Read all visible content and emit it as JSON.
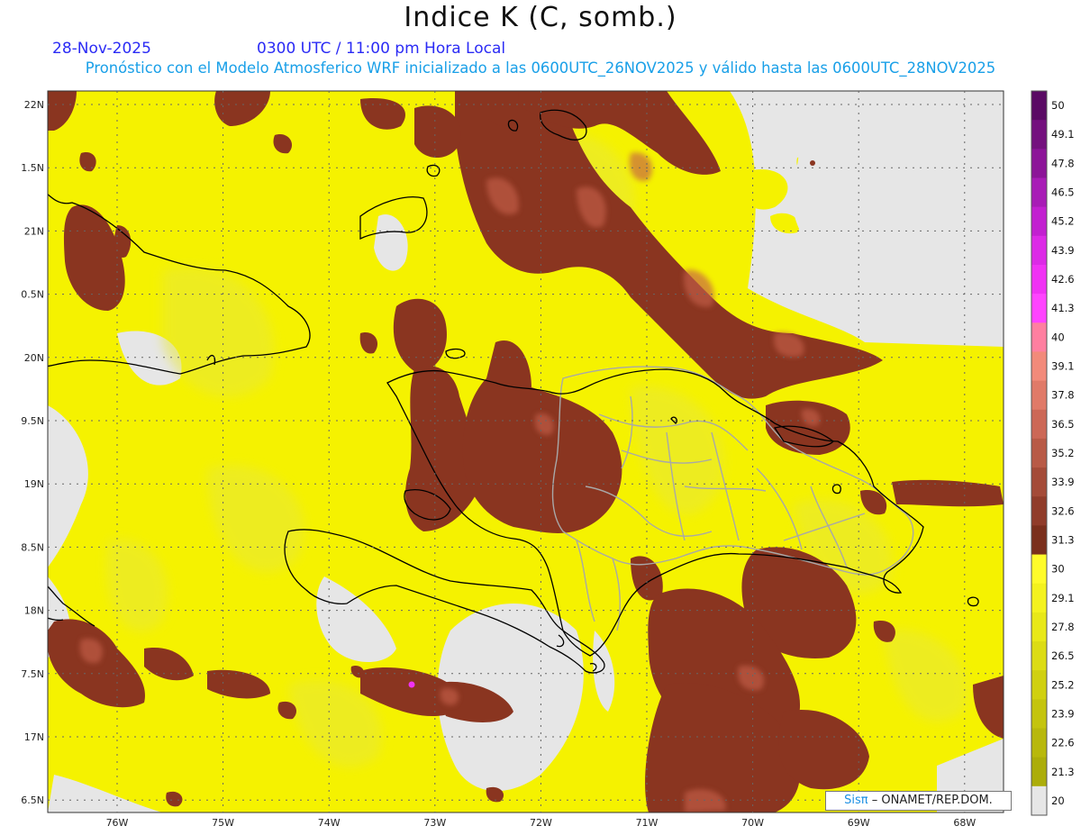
{
  "header": {
    "title": "Indice K (C, somb.)",
    "date": "28-Nov-2025",
    "time": "0300 UTC / 11:00 pm Hora Local",
    "subtitle": "Pronóstico con el Modelo Atmosferico WRF inicializado a las 0600UTC_26NOV2025 y válido hasta las  0600UTC_28NOV2025"
  },
  "map": {
    "lat_ticks": [
      "22N",
      "1.5N",
      "21N",
      "0.5N",
      "20N",
      "9.5N",
      "19N",
      "8.5N",
      "18N",
      "7.5N",
      "17N",
      "6.5N"
    ],
    "lon_ticks": [
      "76W",
      "75W",
      "74W",
      "73W",
      "72W",
      "71W",
      "70W",
      "69W",
      "68W"
    ],
    "colors": {
      "background_no_data": "#e6e6e6",
      "field_low": "#f5f200",
      "field_mid": "#e8e83a",
      "field_high": "#8a3520",
      "field_peak": "#c45f4a",
      "coastline": "#000000",
      "provinces": "#a8a8a8"
    }
  },
  "colorbar": {
    "labels": [
      "50",
      "49.1",
      "47.8",
      "46.5",
      "45.2",
      "43.9",
      "42.6",
      "41.3",
      "40",
      "39.1",
      "37.8",
      "36.5",
      "35.2",
      "33.9",
      "32.6",
      "31.3",
      "30",
      "29.1",
      "27.8",
      "26.5",
      "25.2",
      "23.9",
      "22.6",
      "21.3",
      "20"
    ],
    "colors": [
      "#5a0a64",
      "#74107e",
      "#8c1498",
      "#a81cb6",
      "#c220d0",
      "#dc2ae6",
      "#f032f4",
      "#ff44ff",
      "#ff7fa0",
      "#f28a7a",
      "#e07a68",
      "#cc6856",
      "#b85a46",
      "#a44b38",
      "#903c2a",
      "#7a2f1c",
      "#fffb2a",
      "#f4f21e",
      "#e8e818",
      "#dcdc14",
      "#d0d010",
      "#c4c40e",
      "#b8b80c",
      "#acad0a",
      "#e6e6e6"
    ]
  },
  "credit": {
    "brand": "Sisπ",
    "text": "– ONAMET/REP.DOM."
  }
}
